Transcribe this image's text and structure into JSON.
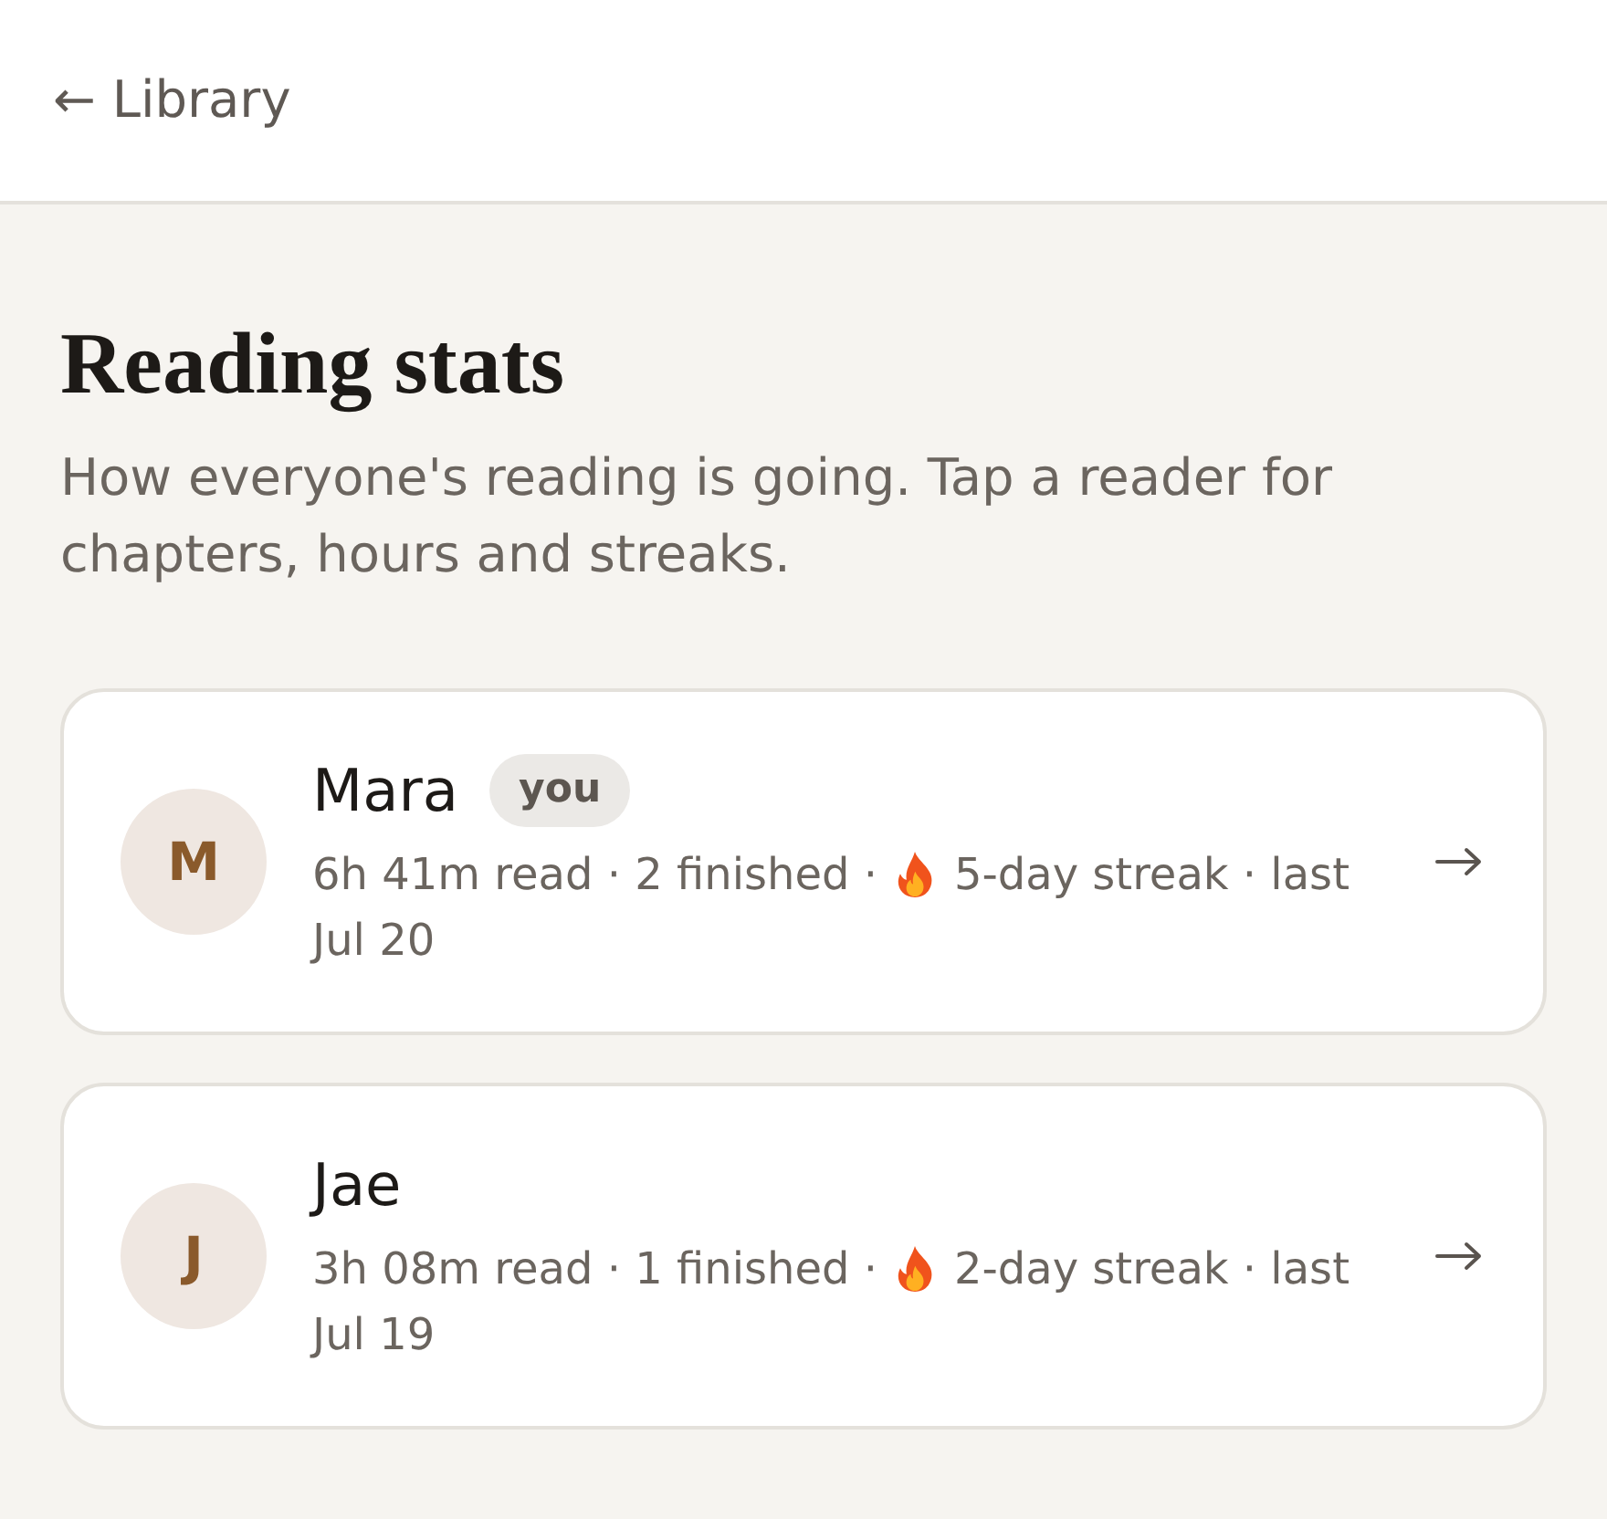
{
  "header": {
    "back_link": "← Library"
  },
  "page": {
    "title": "Reading stats",
    "description": "How everyone's reading is going. Tap a reader for chapters, hours and streaks."
  },
  "readers": [
    {
      "initial": "M",
      "name": "Mara",
      "badge": "you",
      "summary": "6h 41m read · 2 finished ·",
      "streak": "5-day streak · last",
      "last_date": "Jul 20"
    },
    {
      "initial": "J",
      "name": "Jae",
      "summary": "3h 08m read · 1 finished ·",
      "streak": "2-day streak · last",
      "last_date": "Jul 19"
    }
  ]
}
